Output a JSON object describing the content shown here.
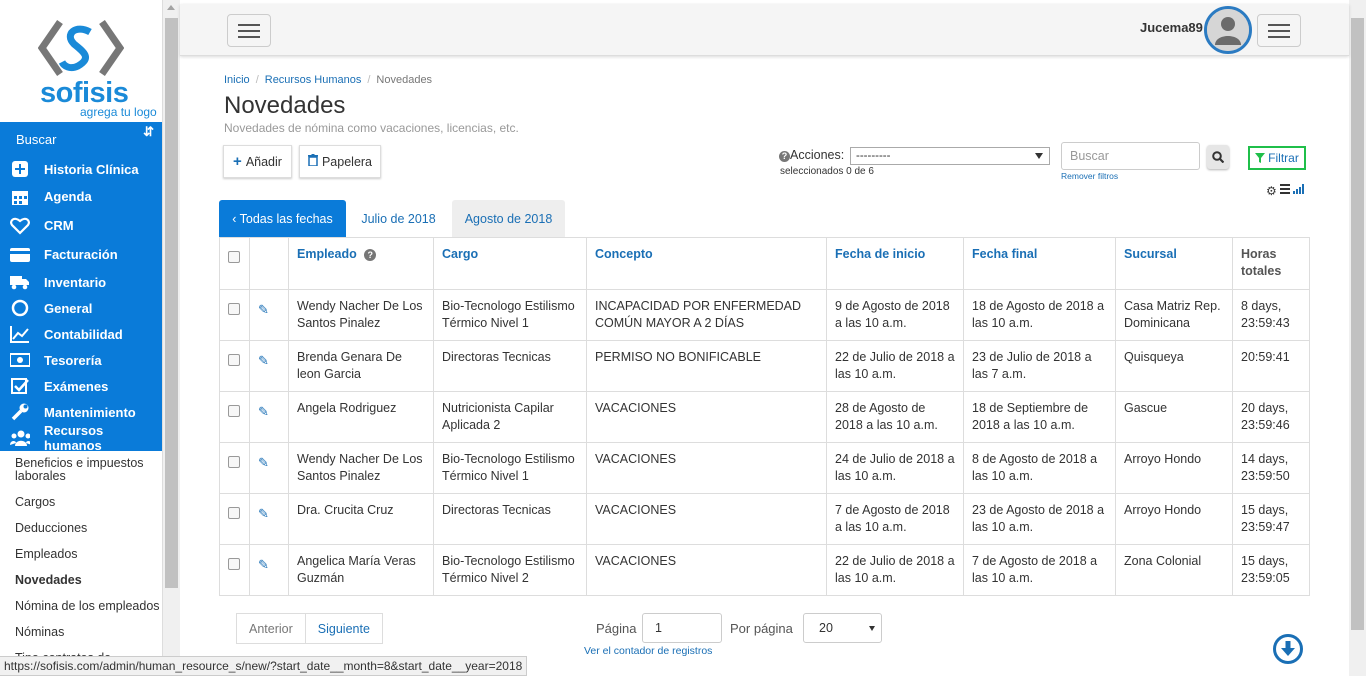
{
  "sidebar": {
    "logo_text": "sofisis",
    "logo_tagline": "agrega tu logo",
    "search_label": "Buscar",
    "items": [
      {
        "label": "Historia Clínica",
        "icon": "plus-square-icon"
      },
      {
        "label": "Agenda",
        "icon": "calendar-icon"
      },
      {
        "label": "CRM",
        "icon": "heart-icon"
      },
      {
        "label": "Facturación",
        "icon": "credit-card-icon"
      },
      {
        "label": "Inventario",
        "icon": "truck-icon"
      },
      {
        "label": "General",
        "icon": "circle-icon"
      },
      {
        "label": "Contabilidad",
        "icon": "chart-icon"
      },
      {
        "label": "Tesorería",
        "icon": "money-icon"
      },
      {
        "label": "Exámenes",
        "icon": "checkbox-icon"
      },
      {
        "label": "Mantenimiento",
        "icon": "wrench-icon"
      },
      {
        "label": "Recursos humanos",
        "icon": "users-icon"
      }
    ],
    "subitems": [
      {
        "label": "Beneficios e impuestos laborales"
      },
      {
        "label": "Cargos"
      },
      {
        "label": "Deducciones"
      },
      {
        "label": "Empleados"
      },
      {
        "label": "Novedades"
      },
      {
        "label": "Nómina de los empleados"
      },
      {
        "label": "Nóminas"
      },
      {
        "label": "Tipo contratos de"
      }
    ]
  },
  "header": {
    "username": "Jucema89"
  },
  "breadcrumb": {
    "home": "Inicio",
    "section": "Recursos Humanos",
    "current": "Novedades"
  },
  "page": {
    "title": "Novedades",
    "subtitle": "Novedades de nómina como vacaciones, licencias, etc.",
    "add_label": "Añadir",
    "trash_label": "Papelera",
    "actions_label": "Acciones:",
    "actions_value": "---------",
    "selected_text": "seleccionados 0 de 6",
    "search_placeholder": "Buscar",
    "remove_filters": "Remover filtros",
    "filter_label": "Filtrar"
  },
  "tabs": [
    {
      "label": "‹ Todas las fechas"
    },
    {
      "label": "Julio de 2018"
    },
    {
      "label": "Agosto de 2018"
    }
  ],
  "table": {
    "headers": {
      "empleado": "Empleado",
      "cargo": "Cargo",
      "concepto": "Concepto",
      "inicio": "Fecha de inicio",
      "final": "Fecha final",
      "sucursal": "Sucursal",
      "horas": "Horas totales"
    },
    "rows": [
      {
        "empleado": "Wendy Nacher De Los Santos Pinalez",
        "cargo": "Bio-Tecnologo Estilismo Térmico Nivel 1",
        "concepto": "INCAPACIDAD POR ENFERMEDAD COMÚN MAYOR A 2 DÍAS",
        "inicio": "9 de Agosto de 2018 a las 10 a.m.",
        "final": "18 de Agosto de 2018 a las 10 a.m.",
        "sucursal": "Casa Matriz Rep. Dominicana",
        "horas": "8 days, 23:59:43"
      },
      {
        "empleado": "Brenda Genara De leon Garcia",
        "cargo": "Directoras Tecnicas",
        "concepto": "PERMISO NO BONIFICABLE",
        "inicio": "22 de Julio de 2018 a las 10 a.m.",
        "final": "23 de Julio de 2018 a las 7 a.m.",
        "sucursal": "Quisqueya",
        "horas": "20:59:41"
      },
      {
        "empleado": "Angela Rodriguez",
        "cargo": "Nutricionista Capilar Aplicada 2",
        "concepto": "VACACIONES",
        "inicio": "28 de Agosto de 2018 a las 10 a.m.",
        "final": "18 de Septiembre de 2018 a las 10 a.m.",
        "sucursal": "Gascue",
        "horas": "20 days, 23:59:46"
      },
      {
        "empleado": "Wendy Nacher De Los Santos Pinalez",
        "cargo": "Bio-Tecnologo Estilismo Térmico Nivel 1",
        "concepto": "VACACIONES",
        "inicio": "24 de Julio de 2018 a las 10 a.m.",
        "final": "8 de Agosto de 2018 a las 10 a.m.",
        "sucursal": "Arroyo Hondo",
        "horas": "14 days, 23:59:50"
      },
      {
        "empleado": "Dra. Crucita Cruz",
        "cargo": "Directoras Tecnicas",
        "concepto": "VACACIONES",
        "inicio": "7 de Agosto de 2018 a las 10 a.m.",
        "final": "23 de Agosto de 2018 a las 10 a.m.",
        "sucursal": "Arroyo Hondo",
        "horas": "15 days, 23:59:47"
      },
      {
        "empleado": "Angelica María Veras Guzmán",
        "cargo": "Bio-Tecnologo Estilismo Térmico Nivel 2",
        "concepto": "VACACIONES",
        "inicio": "22 de Julio de 2018 a las 10 a.m.",
        "final": "7 de Agosto de 2018 a las 10 a.m.",
        "sucursal": "Zona Colonial",
        "horas": "15 days, 23:59:05"
      }
    ]
  },
  "pagination": {
    "prev": "Anterior",
    "next": "Siguiente",
    "page_label": "Página",
    "page_value": "1",
    "per_page_label": "Por página",
    "per_page_value": "20",
    "counter_link": "Ver el contador de registros"
  },
  "status_url": "https://sofisis.com/admin/human_resource_s/new/?start_date__month=8&start_date__year=2018",
  "colors": {
    "primary": "#0a7bd9",
    "link": "#1a6fb5",
    "filter_border": "#1fbf4a"
  }
}
